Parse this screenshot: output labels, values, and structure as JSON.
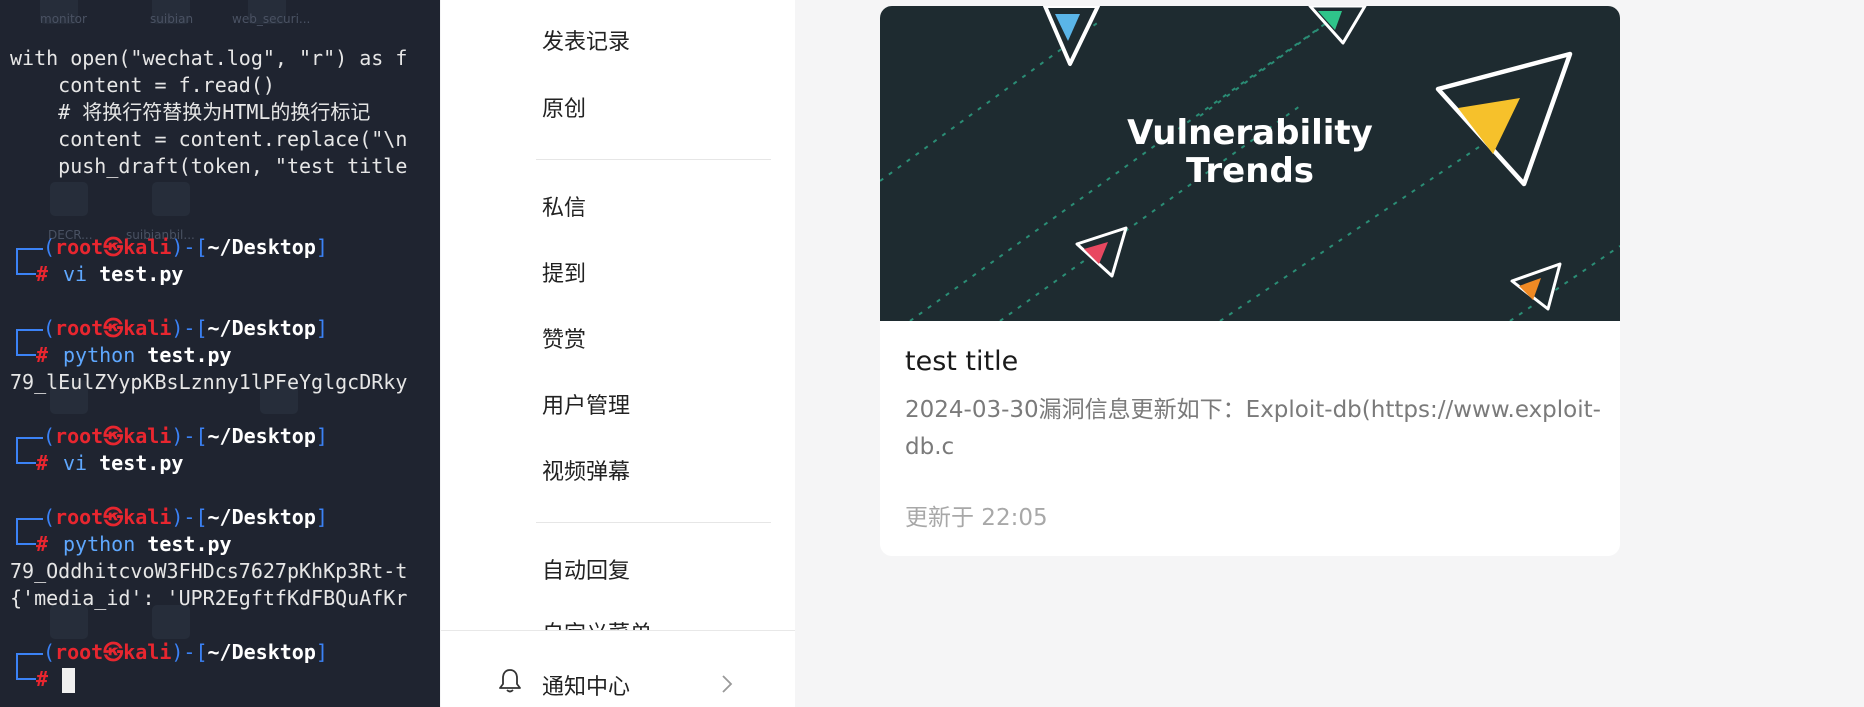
{
  "terminal": {
    "desktop_labels": [
      "monitor",
      "suibian",
      "web_securi...",
      "DECR...",
      "suibianbil..."
    ],
    "code_lines": [
      "with open(\"wechat.log\", \"r\") as f",
      "    content = f.read()",
      "    # 将换行符替换为HTML的换行标记",
      "    content = content.replace(\"\\n",
      "    push_draft(token, \"test title"
    ],
    "prompt": {
      "user": "root",
      "sep": "㉿",
      "host": "kali",
      "path": "~/Desktop",
      "hash": "#"
    },
    "sessions": [
      {
        "cmd": "vi",
        "arg": "test.py",
        "output": []
      },
      {
        "cmd": "python",
        "arg": "test.py",
        "output": [
          "79_lEulZYypKBsLznny1lPFeYglgcDRky"
        ]
      },
      {
        "cmd": "vi",
        "arg": "test.py",
        "output": []
      },
      {
        "cmd": "python",
        "arg": "test.py",
        "output": [
          "79_OddhitcvoW3FHDcs7627pKhKp3Rt-t",
          "{'media_id': 'UPR2EgftfKdFBQuAfKr"
        ]
      }
    ]
  },
  "menu": {
    "items": [
      "发表记录",
      "原创",
      "私信",
      "提到",
      "赞赏",
      "用户管理",
      "视频弹幕",
      "自动回复",
      "自定义菜单"
    ],
    "bottom_label": "通知中心"
  },
  "card": {
    "banner_text": [
      "Vulnerability",
      "Trends"
    ],
    "title": "test title",
    "description": "2024-03-30漏洞信息更新如下：Exploit-db(https://www.exploit-db.c",
    "updated": "更新于 22:05"
  },
  "colors": {
    "terminal_bg": "#1f2430",
    "prompt_blue": "#3b82f6",
    "prompt_red": "#e8262f",
    "banner_bg": "#1e2b30",
    "accent_yellow": "#f6c12b",
    "accent_blue": "#5ab5e8",
    "accent_green": "#2fc48a",
    "accent_red": "#e84860",
    "accent_orange": "#f08a24"
  }
}
